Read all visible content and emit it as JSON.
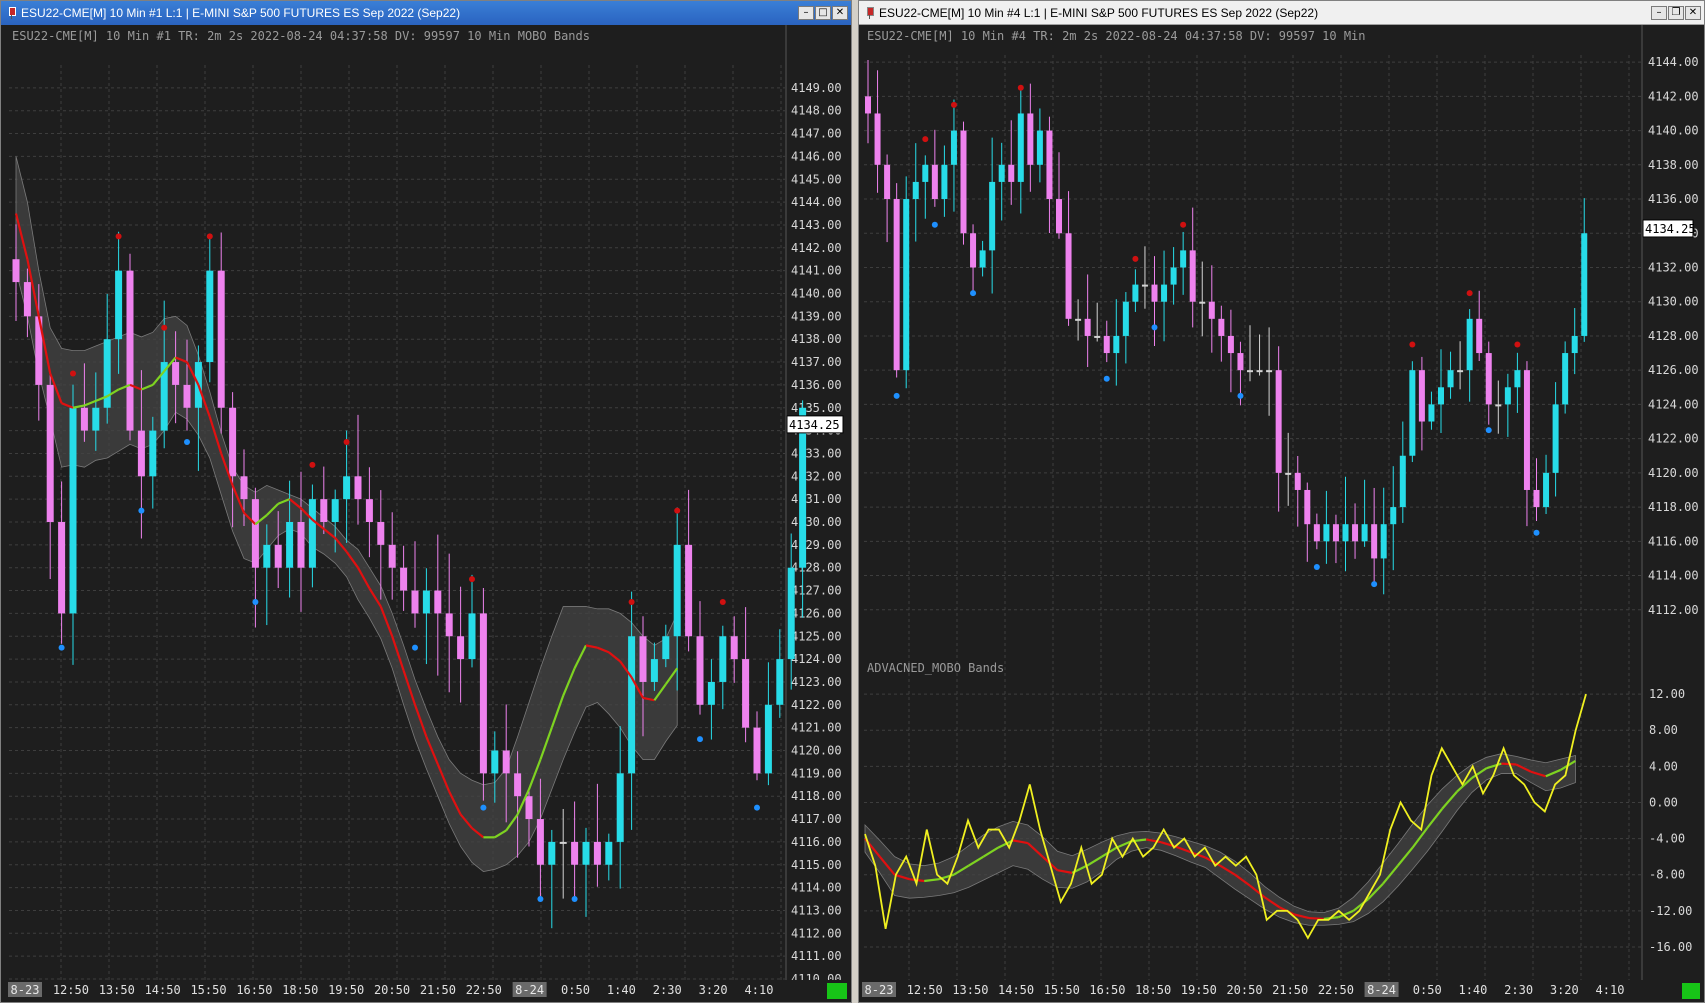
{
  "windows": [
    {
      "title": "ESU22-CME[M]  10 Min   #1 L:1 | E-MINI S&P 500 FUTURES ES Sep 2022 (Sep22)",
      "active": true,
      "header": "ESU22-CME[M]  10 Min   #1 TR: 2m 2s 2022-08-24 04:37:58 DV: 99597 10 Min  MOBO Bands"
    },
    {
      "title": "ESU22-CME[M]  10 Min   #4 L:1 | E-MINI S&P 500 FUTURES ES Sep 2022 (Sep22)",
      "active": false,
      "header": "ESU22-CME[M]  10 Min   #4 TR: 2m 2s 2022-08-24 04:37:58 DV: 99597 10 Min",
      "subpanel_title": "ADVACNED_MOBO Bands"
    }
  ],
  "colors": {
    "up_candle": "#27dce8",
    "down_candle": "#ee82ee",
    "neutral_candle": "#d3d3d3",
    "band_fill": "#444444",
    "mobo_down": "#e01010",
    "mobo_up": "#7ed321",
    "oscillator": "#f0f020",
    "support_dot": "#1e90ff",
    "resistance_dot": "#d01010"
  },
  "chart_data": [
    {
      "type": "candlestick",
      "symbol": "ESU22-CME[M]",
      "interval": "10 Min",
      "last_price": "4134.25",
      "ylim": [
        4110,
        4150
      ],
      "yticks": [
        "4149.00",
        "4148.00",
        "4147.00",
        "4146.00",
        "4145.00",
        "4144.00",
        "4143.00",
        "4142.00",
        "4141.00",
        "4140.00",
        "4139.00",
        "4138.00",
        "4137.00",
        "4136.00",
        "4135.00",
        "4134.00",
        "4133.00",
        "4132.00",
        "4131.00",
        "4130.00",
        "4129.00",
        "4128.00",
        "4127.00",
        "4126.00",
        "4125.00",
        "4124.00",
        "4123.00",
        "4122.00",
        "4121.00",
        "4120.00",
        "4119.00",
        "4118.00",
        "4117.00",
        "4116.00",
        "4115.00",
        "4114.00",
        "4113.00",
        "4112.00",
        "4111.00",
        "4110.00"
      ],
      "xticks": [
        "8-23",
        "12:50",
        "13:50",
        "14:50",
        "15:50",
        "16:50",
        "18:50",
        "19:50",
        "20:50",
        "21:50",
        "22:50",
        "8-24",
        "0:50",
        "1:40",
        "2:30",
        "3:20",
        "4:10"
      ],
      "date_ticks": [
        "8-23",
        "8-24"
      ],
      "closes": [
        4140.5,
        4139,
        4136,
        4130,
        4126,
        4135,
        4134,
        4135,
        4138,
        4141,
        4134,
        4132,
        4134,
        4137,
        4136,
        4135,
        4137,
        4141,
        4135,
        4132,
        4131,
        4128,
        4129,
        4128,
        4130,
        4128,
        4131,
        4130,
        4131,
        4132,
        4131,
        4130,
        4129,
        4128,
        4127,
        4126,
        4127,
        4126,
        4125,
        4124,
        4126,
        4119,
        4120,
        4119,
        4118,
        4117,
        4115,
        4116,
        4116,
        4115,
        4116,
        4115,
        4116,
        4119,
        4125,
        4123,
        4124,
        4125,
        4129,
        4125,
        4122,
        4123,
        4125,
        4124,
        4121,
        4119,
        4122,
        4124,
        4128,
        4135
      ],
      "mobo_mid": [
        4143.5,
        4141.5,
        4139,
        4136.5,
        4135.2,
        4135,
        4135.1,
        4135.3,
        4135.5,
        4135.8,
        4136,
        4135.8,
        4136,
        4136.6,
        4137.2,
        4137,
        4136,
        4134.6,
        4133,
        4131.6,
        4130.4,
        4129.9,
        4130.3,
        4130.8,
        4131,
        4130.6,
        4130.1,
        4129.7,
        4129.3,
        4128.7,
        4128,
        4127.1,
        4126.3,
        4125,
        4123.5,
        4122,
        4120.6,
        4119.4,
        4118.2,
        4117.2,
        4116.6,
        4116.2,
        4116.2,
        4116.5,
        4117.2,
        4118.3,
        4119.6,
        4121,
        4122.4,
        4123.6,
        4124.6,
        4124.5,
        4124.3,
        4123.9,
        4123.2,
        4122.3,
        4122.2,
        4122.9,
        4123.6
      ],
      "band_upper": [
        4146,
        4144,
        4141,
        4138.5,
        4137.6,
        4137.5,
        4137.5,
        4137.7,
        4137.9,
        4138.1,
        4138.3,
        4138.1,
        4138.3,
        4138.9,
        4139,
        4138.6,
        4137.3,
        4135.7,
        4133.9,
        4132.4,
        4131.6,
        4131.3,
        4131.6,
        4131.4,
        4131.2,
        4131,
        4130.6,
        4130.2,
        4129.8,
        4129.2,
        4128.8,
        4128,
        4127.2,
        4126,
        4124.6,
        4123.1,
        4121.8,
        4120.6,
        4119.6,
        4119,
        4118.7,
        4118.5,
        4118.6,
        4119.2,
        4120.6,
        4122.1,
        4123.6,
        4125,
        4126.3,
        4126.3,
        4126.3,
        4126.2,
        4126.2,
        4126,
        4125.6,
        4125,
        4124.6,
        4124.9,
        4126
      ],
      "band_lower": [
        4141,
        4139,
        4136.5,
        4134.5,
        4132.4,
        4132.5,
        4132.4,
        4132.7,
        4132.8,
        4133.1,
        4133.4,
        4133.2,
        4133.4,
        4134,
        4134.8,
        4134.5,
        4133.8,
        4132.8,
        4131.2,
        4129.6,
        4128.4,
        4128.2,
        4128.8,
        4129.4,
        4129.7,
        4129.5,
        4128.9,
        4128.6,
        4128.2,
        4127.6,
        4126.6,
        4125.8,
        4124.9,
        4123.6,
        4122,
        4120.5,
        4119.2,
        4118,
        4116.8,
        4115.8,
        4115.1,
        4114.7,
        4114.8,
        4115,
        4115.4,
        4116,
        4117,
        4118.3,
        4119.6,
        4120.8,
        4121.9,
        4122.1,
        4121.6,
        4121,
        4120.2,
        4119.6,
        4119.6,
        4120.4,
        4121.1
      ],
      "series": [
        {
          "name": "MOBO Bands"
        }
      ]
    },
    {
      "type": "candlestick",
      "symbol": "ESU22-CME[M]",
      "interval": "10 Min",
      "last_price": "4134.25",
      "ylim": [
        4110,
        4145
      ],
      "yticks": [
        "4144.00",
        "4142.00",
        "4140.00",
        "4138.00",
        "4136.00",
        "4134.00",
        "4132.00",
        "4130.00",
        "4128.00",
        "4126.00",
        "4124.00",
        "4122.00",
        "4120.00",
        "4118.00",
        "4116.00",
        "4114.00",
        "4112.00"
      ],
      "closes": [
        4141,
        4138,
        4136,
        4126,
        4136,
        4137,
        4138,
        4136,
        4138,
        4140,
        4134,
        4132,
        4133,
        4137,
        4138,
        4137,
        4141,
        4138,
        4140,
        4136,
        4134,
        4129,
        4129,
        4128,
        4128,
        4127,
        4128,
        4130,
        4131,
        4131,
        4130,
        4131,
        4132,
        4133,
        4130,
        4130,
        4129,
        4128,
        4127,
        4126,
        4126,
        4126,
        4126,
        4120,
        4120,
        4119,
        4117,
        4116,
        4117,
        4116,
        4117,
        4116,
        4117,
        4115,
        4117,
        4118,
        4121,
        4126,
        4123,
        4124,
        4125,
        4126,
        4126,
        4129,
        4127,
        4124,
        4124,
        4125,
        4126,
        4119,
        4118,
        4120,
        4124,
        4127,
        4128,
        4134
      ],
      "subpanel": {
        "title": "ADVACNED_MOBO Bands",
        "ylim": [
          -18,
          15
        ],
        "yticks": [
          "12.00",
          "8.00",
          "4.00",
          "0.00",
          "-4.00",
          "-8.00",
          "-12.00",
          "-16.00"
        ],
        "oscillator": [
          -3.5,
          -7,
          -14,
          -8,
          -6,
          -9,
          -3,
          -8,
          -9,
          -6,
          -2,
          -5,
          -3,
          -3,
          -5,
          -2,
          2,
          -3,
          -7,
          -11,
          -9,
          -5,
          -9,
          -8,
          -4,
          -6,
          -4,
          -6,
          -5,
          -3,
          -5,
          -4,
          -6,
          -5,
          -7,
          -6,
          -7,
          -6,
          -8,
          -13,
          -12,
          -12,
          -13,
          -15,
          -13,
          -13,
          -12,
          -13,
          -12,
          -10,
          -8,
          -3,
          0,
          -2,
          -3,
          3,
          6,
          4,
          2,
          4,
          1,
          3,
          6,
          3,
          2,
          0,
          -1,
          2,
          3,
          8,
          12
        ],
        "mobo_mid": [
          -4,
          -6,
          -8,
          -8.5,
          -8.7,
          -8.5,
          -8,
          -7,
          -6,
          -5,
          -4.2,
          -4.5,
          -6,
          -7.5,
          -7.8,
          -7,
          -6,
          -5,
          -4.3,
          -4.1,
          -4.4,
          -4.9,
          -5.5,
          -6.1,
          -7,
          -8,
          -9.2,
          -10.5,
          -11.6,
          -12.4,
          -12.8,
          -12.9,
          -12.7,
          -12,
          -10.7,
          -9,
          -7,
          -5,
          -2.8,
          -0.7,
          1.2,
          2.7,
          3.8,
          4.3,
          4.2,
          3.4,
          2.9,
          3.6,
          4.6
        ],
        "band_upper": [
          -2.5,
          -4.2,
          -6,
          -6.8,
          -7,
          -6.7,
          -6,
          -4.8,
          -3.6,
          -2.7,
          -2.1,
          -2.5,
          -3.8,
          -5.4,
          -5.9,
          -5.2,
          -4.4,
          -3.7,
          -3.3,
          -3.2,
          -3.4,
          -3.8,
          -4.3,
          -4.8,
          -5.5,
          -6.5,
          -7.8,
          -9.3,
          -10.5,
          -11.5,
          -12.1,
          -12.2,
          -11.7,
          -10.5,
          -8.8,
          -6.7,
          -4.6,
          -2.4,
          -0.3,
          1.5,
          3,
          4.2,
          5,
          5.4,
          5.1,
          4.7,
          4.4,
          4.8,
          5.2
        ],
        "band_lower": [
          -5.5,
          -7.8,
          -10.3,
          -10.6,
          -10.5,
          -10.3,
          -10,
          -9.4,
          -8.6,
          -7.8,
          -7,
          -7.4,
          -8.5,
          -9.4,
          -9.5,
          -8.8,
          -7.7,
          -6.3,
          -5.4,
          -5,
          -5.3,
          -5.9,
          -6.6,
          -7.2,
          -8.4,
          -9.6,
          -10.7,
          -11.8,
          -12.7,
          -13.3,
          -13.6,
          -13.6,
          -13.5,
          -13.2,
          -12.3,
          -11,
          -9.3,
          -7.4,
          -5.4,
          -3.2,
          -0.9,
          1.1,
          2.5,
          3.2,
          3.2,
          2.2,
          1.3,
          1.6,
          2.2
        ],
        "series": [
          {
            "name": "ADVACNED_MOBO Bands"
          }
        ]
      }
    }
  ]
}
